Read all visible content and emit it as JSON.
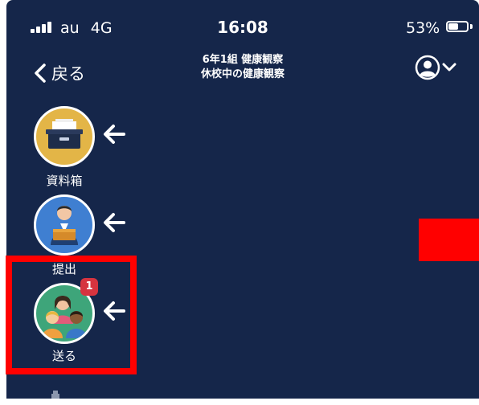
{
  "status_bar": {
    "carrier": "au",
    "network": "4G",
    "time": "16:08",
    "battery_percent": "53%",
    "battery_level": 0.53
  },
  "nav": {
    "back_label": "戻る",
    "title_line1": "6年1組 健康観察",
    "title_line2": "休校中の健康観察",
    "account_icon": "person-circle-icon"
  },
  "sidebar": {
    "items": [
      {
        "label": "資料箱",
        "icon": "file-box-icon",
        "bg": "#e3b547"
      },
      {
        "label": "提出",
        "icon": "student-submit-icon",
        "bg": "#3f7fd1"
      },
      {
        "label": "送る",
        "icon": "people-group-icon",
        "bg": "#3ea57a",
        "badge": "1"
      }
    ]
  },
  "colors": {
    "background": "#15264a",
    "highlight": "#ff0000",
    "badge": "#d6343f"
  }
}
